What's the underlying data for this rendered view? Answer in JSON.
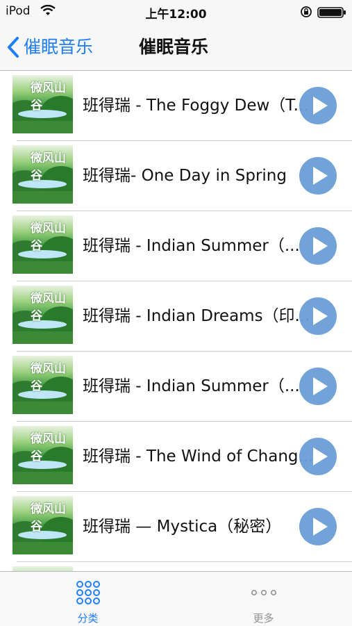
{
  "status_bar": {
    "carrier": "iPod",
    "time": "上午12:00"
  },
  "nav": {
    "back_label": "催眠音乐",
    "title": "催眠音乐"
  },
  "cover": {
    "title": "微风山谷"
  },
  "tracks": [
    {
      "title": "班得瑞 - The Foggy Dew（T..."
    },
    {
      "title": "班得瑞- One Day in Spring"
    },
    {
      "title": "班得瑞 - Indian Summer（..."
    },
    {
      "title": "班得瑞 - Indian Dreams（印..."
    },
    {
      "title": "班得瑞 - Indian Summer（..."
    },
    {
      "title": "班得瑞 - The Wind of Chang..."
    },
    {
      "title": "班得瑞 — Mystica（秘密）"
    }
  ],
  "tab_bar": {
    "items": [
      {
        "label": "分类"
      },
      {
        "label": "更多"
      }
    ]
  },
  "colors": {
    "accent": "#1f7ef7",
    "play_button": "#6a9ed6",
    "tab_inactive": "#929292"
  }
}
